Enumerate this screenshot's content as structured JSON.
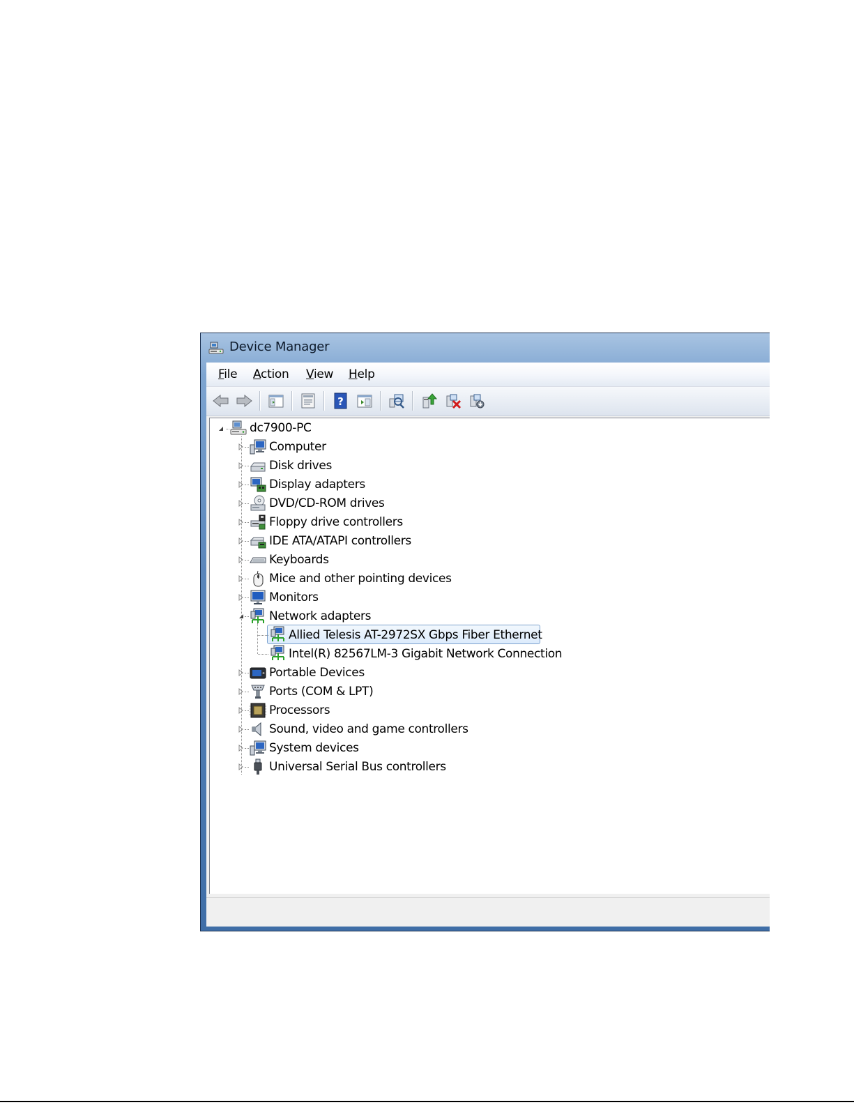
{
  "window": {
    "title": "Device Manager",
    "title_icon": "device-manager-icon"
  },
  "menu": [
    {
      "label": "File"
    },
    {
      "label": "Action"
    },
    {
      "label": "View"
    },
    {
      "label": "Help"
    }
  ],
  "toolbar": [
    "back-arrow-icon",
    "forward-arrow-icon",
    "show-hide-tree-icon",
    "properties-icon",
    "help-icon",
    "show-hide-action-pane-icon",
    "scan-hardware-icon",
    "update-driver-icon",
    "uninstall-icon",
    "disable-device-icon"
  ],
  "tree": {
    "root": {
      "label": "dc7900-PC",
      "icon": "computer-network-icon",
      "expanded": true
    },
    "categories": [
      {
        "label": "Computer",
        "icon": "computer-icon"
      },
      {
        "label": "Disk drives",
        "icon": "disk-drive-icon"
      },
      {
        "label": "Display adapters",
        "icon": "display-adapter-icon"
      },
      {
        "label": "DVD/CD-ROM drives",
        "icon": "dvd-drive-icon"
      },
      {
        "label": "Floppy drive controllers",
        "icon": "floppy-controller-icon"
      },
      {
        "label": "IDE ATA/ATAPI controllers",
        "icon": "ide-controller-icon"
      },
      {
        "label": "Keyboards",
        "icon": "keyboard-icon"
      },
      {
        "label": "Mice and other pointing devices",
        "icon": "mouse-icon"
      },
      {
        "label": "Monitors",
        "icon": "monitor-icon"
      },
      {
        "label": "Network adapters",
        "icon": "network-adapter-icon",
        "expanded": true,
        "children": [
          {
            "label": "Allied Telesis AT-2972SX Gbps Fiber Ethernet",
            "icon": "network-adapter-icon",
            "selected": true
          },
          {
            "label": "Intel(R) 82567LM-3 Gigabit Network Connection",
            "icon": "network-adapter-icon"
          }
        ]
      },
      {
        "label": "Portable Devices",
        "icon": "portable-device-icon"
      },
      {
        "label": "Ports (COM & LPT)",
        "icon": "port-icon"
      },
      {
        "label": "Processors",
        "icon": "processor-icon"
      },
      {
        "label": "Sound, video and game controllers",
        "icon": "speaker-icon"
      },
      {
        "label": "System devices",
        "icon": "system-device-icon"
      },
      {
        "label": "Universal Serial Bus controllers",
        "icon": "usb-icon"
      }
    ]
  },
  "colors": {
    "title_gradient_top": "#a9c4e2",
    "title_gradient_bottom": "#3f6ea7",
    "selection_border": "#7da2ce"
  }
}
